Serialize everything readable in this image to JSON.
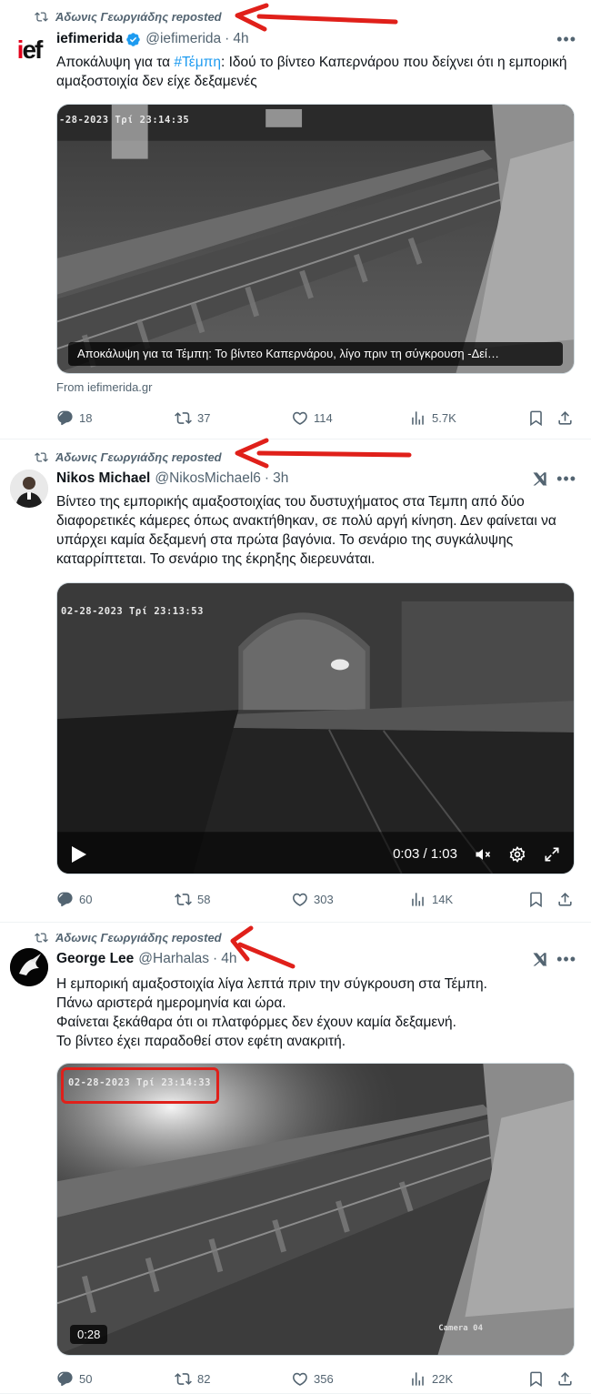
{
  "tweets": [
    {
      "repost_by": "Άδωνις Γεωργιάδης reposted",
      "name": "iefimerida",
      "verified": true,
      "handle": "@iefimerida",
      "time": "4h",
      "text_before": "Αποκάλυψη για τα ",
      "hashtag": "#Τέμπη",
      "text_after": ": Ιδού το βίντεο Καπερνάρου που δείχνει ότι η εμπορική αμαξοστοιχία δεν είχε δεξαμενές",
      "media": {
        "stamp": "-28-2023 Τρί 23:14:35",
        "card_title": "Αποκάλυψη για τα Τέμπη: Το βίντεο Καπερνάρου, λίγο πριν τη σύγκρουση -Δεί…",
        "source": "From iefimerida.gr"
      },
      "stats": {
        "replies": "18",
        "reposts": "37",
        "likes": "114",
        "views": "5.7K"
      }
    },
    {
      "repost_by": "Άδωνις Γεωργιάδης reposted",
      "name": "Nikos Michael",
      "handle": "@NikosMichael6",
      "time": "3h",
      "text": "Βίντεο της εμπορικής αμαξοστοιχίας του δυστυχήματος στα Τεμπη από δύο διαφορετικές κάμερες όπως ανακτήθηκαν, σε πολύ αργή κίνηση. Δεν φαίνεται να υπάρχει καμία δεξαμενή στα πρώτα βαγόνια. Το σενάριο της συγκάλυψης καταρρίπτεται. Το σενάριο της έκρηξης διερευνάται.",
      "media": {
        "stamp": "02-28-2023 Τρί 23:13:53",
        "time_display": "0:03 / 1:03"
      },
      "stats": {
        "replies": "60",
        "reposts": "58",
        "likes": "303",
        "views": "14K"
      }
    },
    {
      "repost_by": "Άδωνις Γεωργιάδης reposted",
      "name": "George Lee",
      "handle": "@Harhalas",
      "time": "4h",
      "lines": [
        "Η εμπορική αμαξοστοιχία λίγα λεπτά πριν την σύγκρουση στα Τέμπη.",
        "Πάνω αριστερά ημερομηνία και ώρα.",
        "Φαίνεται ξεκάθαρα ότι οι πλατφόρμες δεν έχουν καμία δεξαμενή.",
        "Το βίντεο έχει παραδοθεί στον εφέτη ανακριτή."
      ],
      "media": {
        "stamp": "02-28-2023 Τρί 23:14:33",
        "duration": "0:28",
        "camera": "Camera 04"
      },
      "stats": {
        "replies": "50",
        "reposts": "82",
        "likes": "356",
        "views": "22K"
      }
    }
  ],
  "colors": {
    "accent": "#1d9bf0",
    "muted": "#536471",
    "annotation_red": "#e0201a"
  },
  "icons": [
    "repost-icon",
    "verified-badge-icon",
    "more-icon",
    "grok-icon",
    "reply-icon",
    "like-icon",
    "views-icon",
    "bookmark-icon",
    "share-icon",
    "play-icon",
    "mute-icon",
    "settings-icon",
    "fullscreen-icon"
  ]
}
